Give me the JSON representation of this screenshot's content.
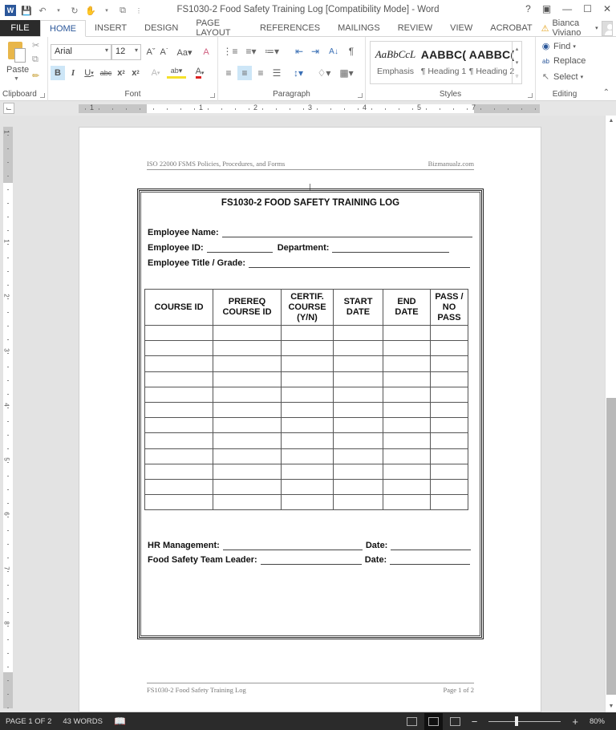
{
  "window": {
    "title": "FS1030-2 Food Safety Training Log [Compatibility Mode] - Word",
    "controls": [
      "?",
      "ribbon-display",
      "minimize",
      "maximize",
      "close"
    ],
    "quick_access": [
      "word-logo",
      "save",
      "undo",
      "redo",
      "touch-mode",
      "customize"
    ]
  },
  "tabs": [
    "FILE",
    "HOME",
    "INSERT",
    "DESIGN",
    "PAGE LAYOUT",
    "REFERENCES",
    "MAILINGS",
    "REVIEW",
    "VIEW",
    "ACROBAT"
  ],
  "active_tab": "HOME",
  "user": {
    "name": "Bianca Viviano",
    "warning": true
  },
  "ribbon": {
    "clipboard": {
      "paste_label": "Paste",
      "group_label": "Clipboard"
    },
    "font": {
      "font_name": "Arial",
      "font_size": "12",
      "group_label": "Font",
      "bold_active": true
    },
    "paragraph": {
      "group_label": "Paragraph",
      "active_alignment": "center"
    },
    "styles": {
      "group_label": "Styles",
      "items": [
        {
          "sample": "AaBbCcL",
          "name": "Emphasis"
        },
        {
          "sample": "AABBC(",
          "name": "¶ Heading 1"
        },
        {
          "sample": "AABBC(",
          "name": "¶ Heading 2"
        }
      ]
    },
    "editing": {
      "group_label": "Editing",
      "find": "Find",
      "replace": "Replace",
      "select": "Select"
    }
  },
  "ruler": {
    "labels": [
      "1",
      "1",
      "2",
      "3",
      "4",
      "5",
      "7"
    ],
    "vertical_labels": [
      "1",
      "1",
      "2",
      "3",
      "4",
      "5",
      "6",
      "7",
      "8"
    ]
  },
  "document": {
    "header_left": "ISO 22000 FSMS Policies, Procedures, and Forms",
    "header_right": "Bizmanualz.com",
    "footer_left": "FS1030-2 Food Safety Training Log",
    "footer_right": "Page 1 of 2",
    "form": {
      "title": "FS1030-2 FOOD SAFETY TRAINING LOG",
      "employee_name": "Employee Name:",
      "employee_id": "Employee ID:",
      "department": "Department:",
      "employee_title": "Employee Title / Grade:",
      "table_headers": [
        "COURSE ID",
        "PREREQ\nCOURSE ID",
        "CERTIF.\nCOURSE\n(Y/N)",
        "START\nDATE",
        "END\nDATE",
        "PASS /\nNO\nPASS"
      ],
      "table_row_count": 12,
      "hr_management": "HR Management:",
      "team_leader": "Food Safety Team Leader:",
      "date": "Date:"
    }
  },
  "status": {
    "page": "PAGE 1 OF 2",
    "words": "43 WORDS",
    "zoom": "80%",
    "zoom_percent": 80
  }
}
